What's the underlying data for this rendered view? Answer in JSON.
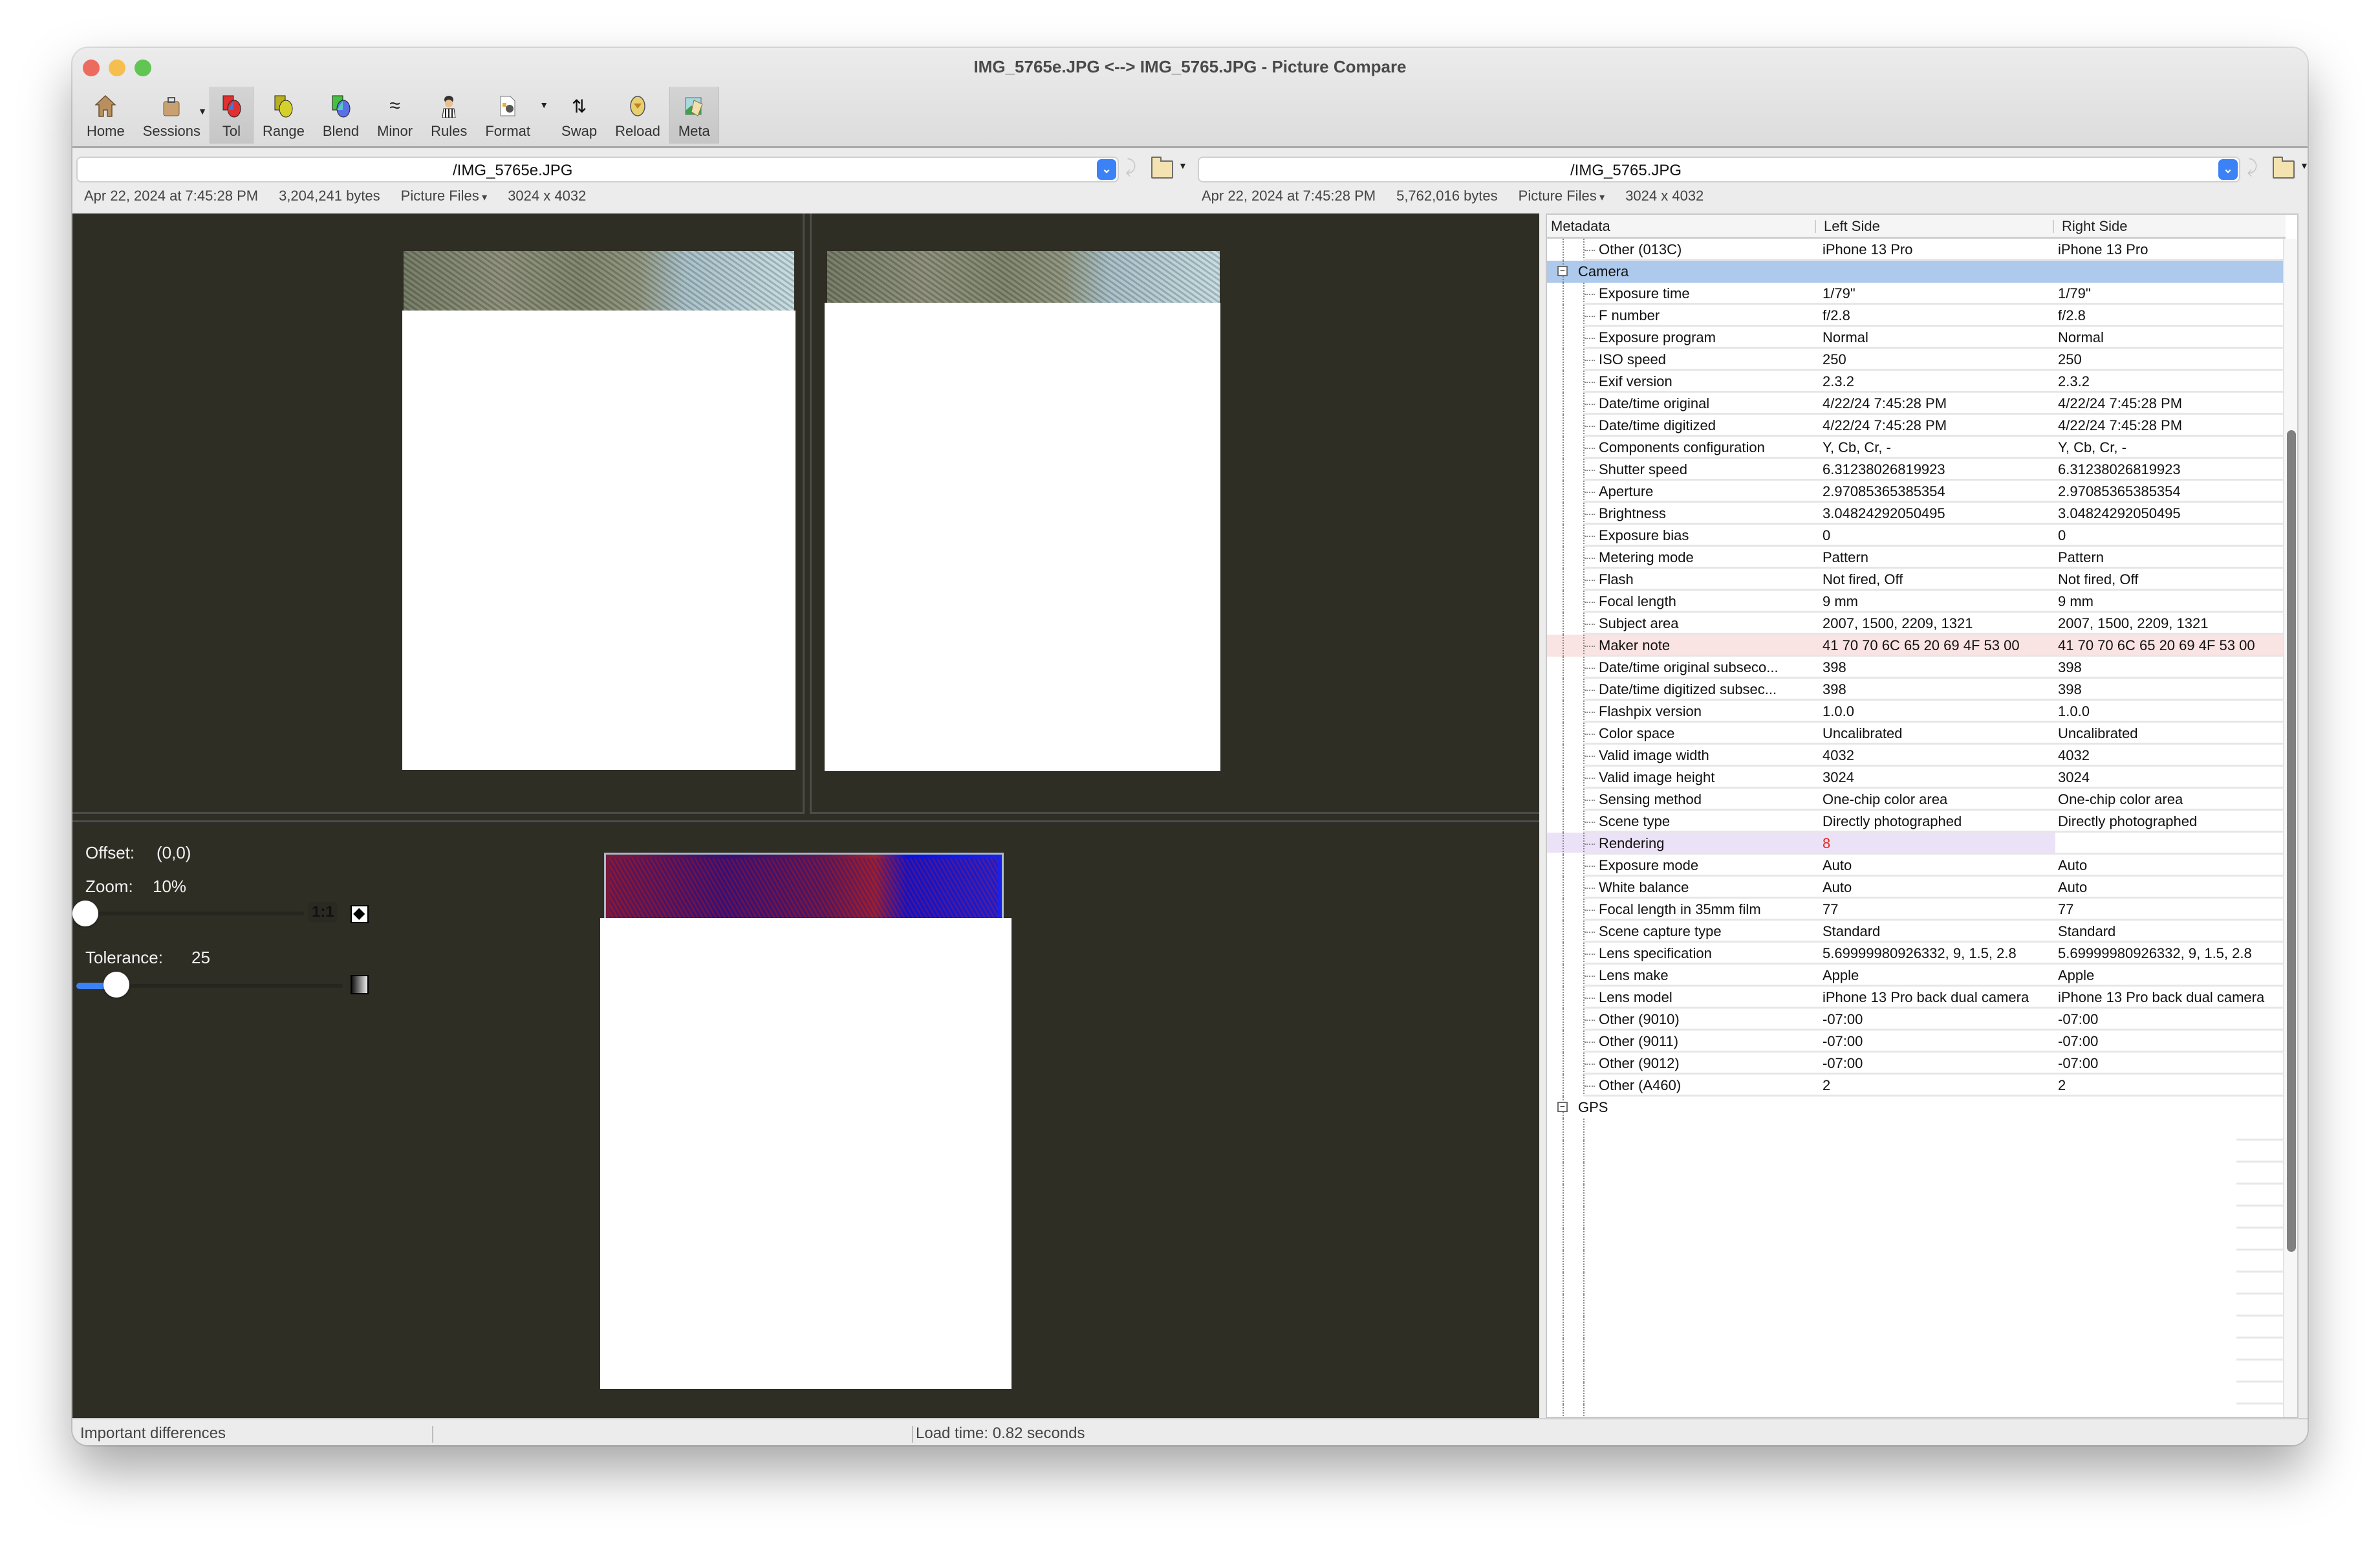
{
  "window": {
    "title": "IMG_5765e.JPG <--> IMG_5765.JPG - Picture Compare"
  },
  "toolbar": {
    "items": [
      {
        "label": "Home",
        "icon": "home-icon"
      },
      {
        "label": "Sessions",
        "icon": "briefcase-icon",
        "has_menu": true
      },
      {
        "label": "Tol",
        "icon": "tolerance-icon",
        "active": true
      },
      {
        "label": "Range",
        "icon": "range-icon"
      },
      {
        "label": "Blend",
        "icon": "blend-icon"
      },
      {
        "label": "Minor",
        "icon": "approx-icon"
      },
      {
        "label": "Rules",
        "icon": "referee-icon"
      },
      {
        "label": "Format",
        "icon": "format-icon",
        "has_menu": true
      },
      {
        "label": "Swap",
        "icon": "swap-icon"
      },
      {
        "label": "Reload",
        "icon": "reload-icon"
      },
      {
        "label": "Meta",
        "icon": "meta-icon",
        "active": true
      }
    ]
  },
  "left_file": {
    "path": "/IMG_5765e.JPG",
    "date": "Apr 22, 2024 at 7:45:28 PM",
    "size": "3,204,241 bytes",
    "filter": "Picture Files",
    "dimensions": "3024 x 4032"
  },
  "right_file": {
    "path": "/IMG_5765.JPG",
    "date": "Apr 22, 2024 at 7:45:28 PM",
    "size": "5,762,016 bytes",
    "filter": "Picture Files",
    "dimensions": "3024 x 4032"
  },
  "controls": {
    "offset_label": "Offset:",
    "offset_value": "(0,0)",
    "zoom_label": "Zoom:",
    "zoom_value": "10%",
    "zoom_slider_fraction": 0.0,
    "one_to_one_label": "1:1",
    "tolerance_label": "Tolerance:",
    "tolerance_value": "25",
    "tolerance_slider_fraction": 0.1
  },
  "metadata": {
    "columns": [
      "Metadata",
      "Left Side",
      "Right Side"
    ],
    "rows": [
      {
        "name": "Other (013C)",
        "left": "iPhone 13 Pro",
        "right": "iPhone 13 Pro",
        "state": "same"
      },
      {
        "name": "Camera",
        "left": "",
        "right": "",
        "state": "group-selected"
      },
      {
        "name": "Exposure time",
        "left": "1/79\"",
        "right": "1/79\"",
        "state": "same"
      },
      {
        "name": "F number",
        "left": "f/2.8",
        "right": "f/2.8",
        "state": "same"
      },
      {
        "name": "Exposure program",
        "left": "Normal",
        "right": "Normal",
        "state": "same"
      },
      {
        "name": "ISO speed",
        "left": "250",
        "right": "250",
        "state": "same"
      },
      {
        "name": "Exif version",
        "left": "2.3.2",
        "right": "2.3.2",
        "state": "same"
      },
      {
        "name": "Date/time original",
        "left": "4/22/24 7:45:28 PM",
        "right": "4/22/24 7:45:28 PM",
        "state": "same"
      },
      {
        "name": "Date/time digitized",
        "left": "4/22/24 7:45:28 PM",
        "right": "4/22/24 7:45:28 PM",
        "state": "same"
      },
      {
        "name": "Components configuration",
        "left": "Y, Cb, Cr, -",
        "right": "Y, Cb, Cr, -",
        "state": "same"
      },
      {
        "name": "Shutter speed",
        "left": "6.31238026819923",
        "right": "6.31238026819923",
        "state": "same"
      },
      {
        "name": "Aperture",
        "left": "2.97085365385354",
        "right": "2.97085365385354",
        "state": "same"
      },
      {
        "name": "Brightness",
        "left": "3.04824292050495",
        "right": "3.04824292050495",
        "state": "same"
      },
      {
        "name": "Exposure bias",
        "left": "0",
        "right": "0",
        "state": "same"
      },
      {
        "name": "Metering mode",
        "left": "Pattern",
        "right": "Pattern",
        "state": "same"
      },
      {
        "name": "Flash",
        "left": "Not fired, Off",
        "right": "Not fired, Off",
        "state": "same"
      },
      {
        "name": "Focal length",
        "left": "9 mm",
        "right": "9 mm",
        "state": "same"
      },
      {
        "name": "Subject area",
        "left": "2007, 1500, 2209, 1321",
        "right": "2007, 1500, 2209, 1321",
        "state": "same"
      },
      {
        "name": "Maker note",
        "left": "41 70 70 6C 65 20 69 4F 53 00",
        "right": "41 70 70 6C 65 20 69 4F 53 00",
        "state": "diff"
      },
      {
        "name": "Date/time original subseco...",
        "left": "398",
        "right": "398",
        "state": "same"
      },
      {
        "name": "Date/time digitized subsec...",
        "left": "398",
        "right": "398",
        "state": "same"
      },
      {
        "name": "Flashpix version",
        "left": "1.0.0",
        "right": "1.0.0",
        "state": "same"
      },
      {
        "name": "Color space",
        "left": "Uncalibrated",
        "right": "Uncalibrated",
        "state": "same"
      },
      {
        "name": "Valid image width",
        "left": "4032",
        "right": "4032",
        "state": "same"
      },
      {
        "name": "Valid image height",
        "left": "3024",
        "right": "3024",
        "state": "same"
      },
      {
        "name": "Sensing method",
        "left": "One-chip color area",
        "right": "One-chip color area",
        "state": "same"
      },
      {
        "name": "Scene type",
        "left": "Directly photographed",
        "right": "Directly photographed",
        "state": "same"
      },
      {
        "name": "Rendering",
        "left": "8",
        "right": "",
        "state": "missing"
      },
      {
        "name": "Exposure mode",
        "left": "Auto",
        "right": "Auto",
        "state": "same"
      },
      {
        "name": "White balance",
        "left": "Auto",
        "right": "Auto",
        "state": "same"
      },
      {
        "name": "Focal length in 35mm film",
        "left": "77",
        "right": "77",
        "state": "same"
      },
      {
        "name": "Scene capture type",
        "left": "Standard",
        "right": "Standard",
        "state": "same"
      },
      {
        "name": "Lens specification",
        "left": "5.69999980926332, 9, 1.5, 2.8",
        "right": "5.69999980926332, 9, 1.5, 2.8",
        "state": "same"
      },
      {
        "name": "Lens make",
        "left": "Apple",
        "right": "Apple",
        "state": "same"
      },
      {
        "name": "Lens model",
        "left": "iPhone 13 Pro back dual camera",
        "right": "iPhone 13 Pro back dual camera",
        "state": "same"
      },
      {
        "name": "Other (9010)",
        "left": "-07:00",
        "right": "-07:00",
        "state": "same"
      },
      {
        "name": "Other (9011)",
        "left": "-07:00",
        "right": "-07:00",
        "state": "same"
      },
      {
        "name": "Other (9012)",
        "left": "-07:00",
        "right": "-07:00",
        "state": "same"
      },
      {
        "name": "Other (A460)",
        "left": "2",
        "right": "2",
        "state": "same"
      },
      {
        "name": "GPS",
        "left": "",
        "right": "",
        "state": "group"
      }
    ]
  },
  "status": {
    "left": "Important differences",
    "right": "Load time: 0.82 seconds"
  },
  "colors": {
    "viewer_bg": "#2e2e25",
    "selected_row": "#adc9eb",
    "diff_row": "#fae3e3",
    "missing_row": "#ebe2f8",
    "missing_text": "#e8261f",
    "accent": "#3b82f6"
  }
}
